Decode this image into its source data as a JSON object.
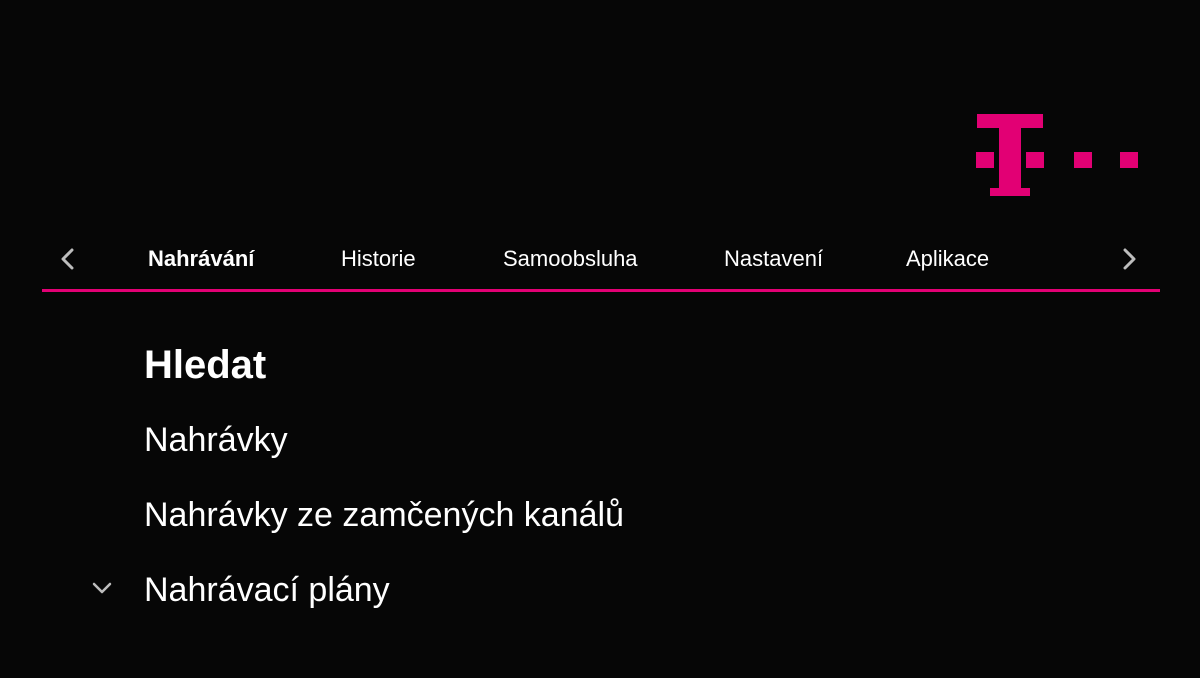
{
  "colors": {
    "accent": "#e20074",
    "background": "#060606",
    "text": "#ffffff",
    "arrow": "#bdbdbd"
  },
  "logo": {
    "name": "telekom-logo",
    "text": "T"
  },
  "nav": {
    "prev_icon": "chevron-left-icon",
    "next_icon": "chevron-right-icon",
    "tabs": [
      {
        "label": "Nahrávání",
        "active": true
      },
      {
        "label": "Historie",
        "active": false
      },
      {
        "label": "Samoobsluha",
        "active": false
      },
      {
        "label": "Nastavení",
        "active": false
      },
      {
        "label": "Aplikace",
        "active": false
      }
    ]
  },
  "menu": {
    "items": [
      {
        "label": "Hledat",
        "selected": true
      },
      {
        "label": "Nahrávky",
        "selected": false
      },
      {
        "label": "Nahrávky ze zamčených kanálů",
        "selected": false
      },
      {
        "label": "Nahrávací plány",
        "selected": false,
        "expandable": true
      }
    ],
    "expand_icon": "chevron-down-icon"
  }
}
